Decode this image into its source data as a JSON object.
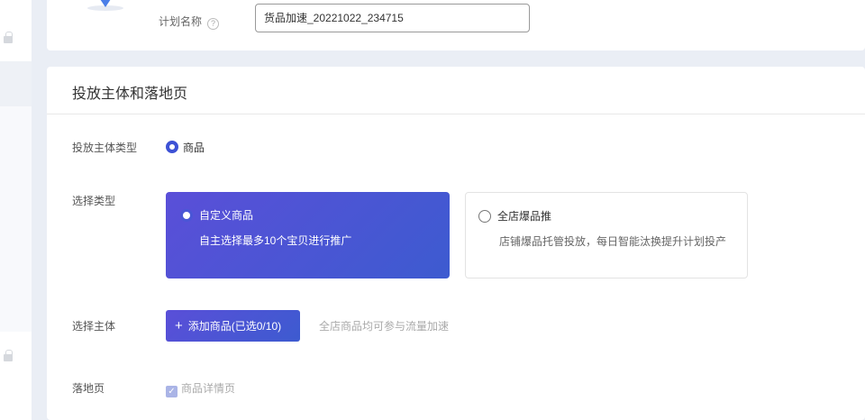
{
  "plan": {
    "name_label": "计划名称",
    "help_icon": "?",
    "name_value": "货品加速_20221022_234715"
  },
  "section": {
    "title": "投放主体和落地页",
    "subject_type_label": "投放主体类型",
    "subject_type_value": "商品",
    "select_type_label": "选择类型",
    "options": [
      {
        "title": "自定义商品",
        "desc": "自主选择最多10个宝贝进行推广",
        "selected": true
      },
      {
        "title": "全店爆品推",
        "desc": "店铺爆品托管投放，每日智能汰换提升计划投产",
        "selected": false
      }
    ],
    "select_subject_label": "选择主体",
    "add_button": "添加商品(已选0/10)",
    "add_icon": "+",
    "add_hint": "全店商品均可参与流量加速",
    "landing_label": "落地页",
    "landing_checkbox": "商品详情页",
    "check_icon": "✓"
  },
  "colors": {
    "accent": "#3d52d5"
  }
}
